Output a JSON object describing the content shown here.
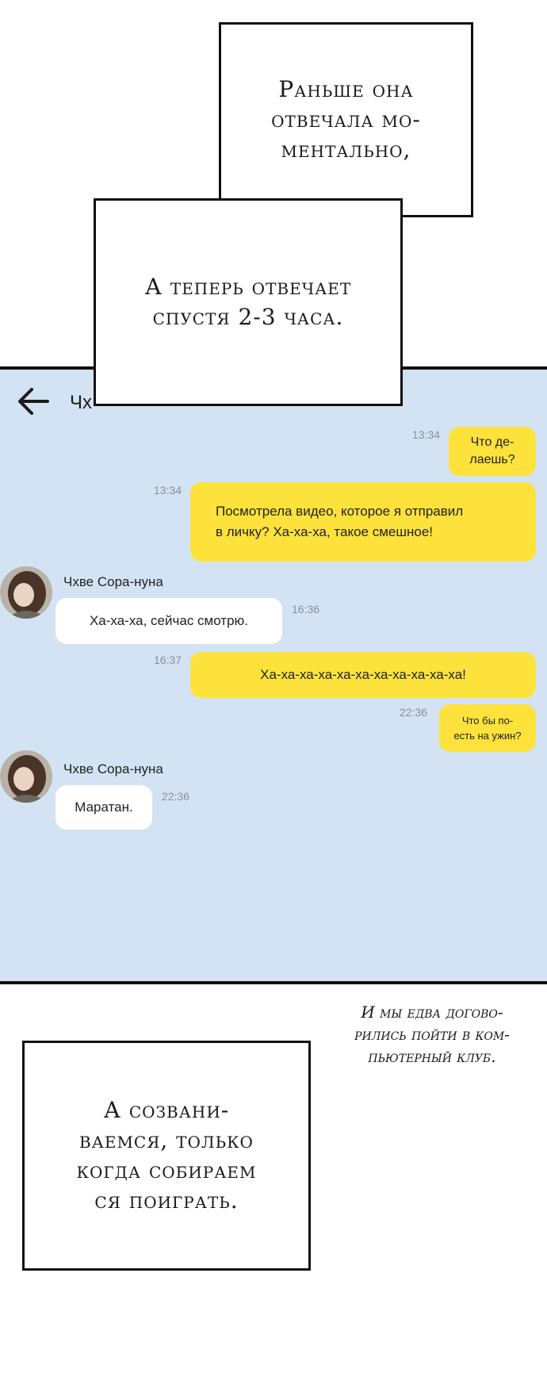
{
  "captions": {
    "top": "Раньше она\nотвечала мо-\nментально,",
    "middle": "А теперь отвечает\nспустя 2-3 часа.",
    "narration": "И мы едва догово-\nрились пойти в ком-\nпьютерный клуб.",
    "bottom": "А созвани-\nваемся, только\nкогда собираем\nся поиграть."
  },
  "chat": {
    "header": {
      "back_icon": "arrow-left-icon",
      "title_visible_fragment": "Чх"
    },
    "messages": [
      {
        "id": "m1",
        "side": "right",
        "time": "13:34",
        "text": "Что де-\nлаешь?"
      },
      {
        "id": "m2",
        "side": "right",
        "time": "13:34",
        "text": "Посмотрела видео, которое я отправил\nв личку? Ха-ха-ха, такое смешное!"
      },
      {
        "id": "m3",
        "side": "left",
        "sender": "Чхве Сора-нуна",
        "time": "16:36",
        "text": "Ха-ха-ха, сейчас смотрю."
      },
      {
        "id": "m4",
        "side": "right",
        "time": "16:37",
        "text": "Ха-ха-ха-ха-ха-ха-ха-ха-ха-ха-ха!"
      },
      {
        "id": "m5",
        "side": "right",
        "time": "22:36",
        "text": "Что бы по-\nесть на ужин?"
      },
      {
        "id": "m6",
        "side": "left",
        "sender": "Чхве Сора-нуна",
        "time": "22:36",
        "text": "Маратан."
      }
    ],
    "colors": {
      "panel_bg": "#d3e3f4",
      "outgoing_bubble": "#fde23b",
      "incoming_bubble": "#ffffff"
    }
  }
}
